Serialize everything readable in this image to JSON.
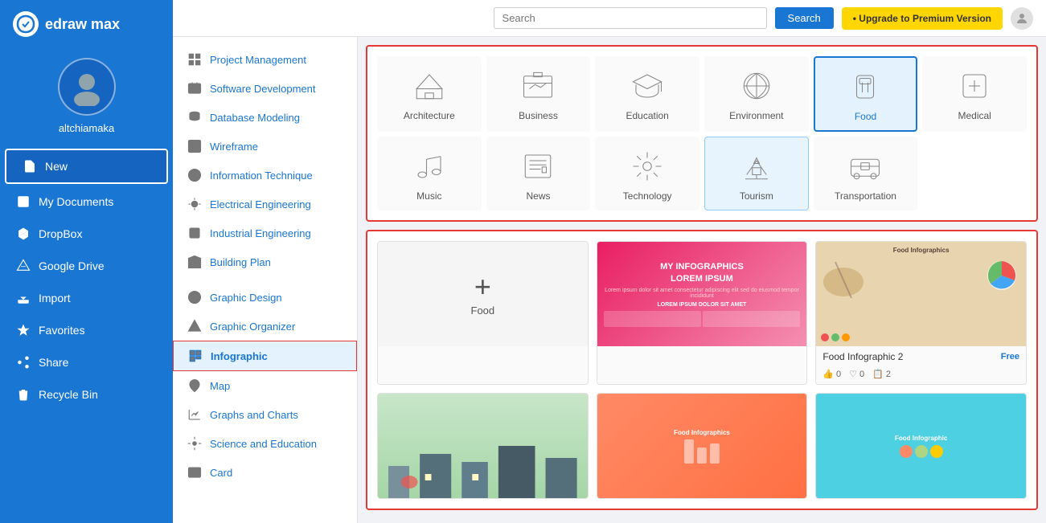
{
  "app": {
    "name": "edraw max"
  },
  "sidebar": {
    "username": "altchiamaka",
    "items": [
      {
        "id": "new",
        "label": "New",
        "active": true
      },
      {
        "id": "my-documents",
        "label": "My Documents",
        "active": false
      },
      {
        "id": "dropbox",
        "label": "DropBox",
        "active": false
      },
      {
        "id": "google-drive",
        "label": "Google Drive",
        "active": false
      },
      {
        "id": "import",
        "label": "Import",
        "active": false
      },
      {
        "id": "favorites",
        "label": "Favorites",
        "active": false
      },
      {
        "id": "share",
        "label": "Share",
        "active": false
      },
      {
        "id": "recycle-bin",
        "label": "Recycle Bin",
        "active": false
      }
    ]
  },
  "topbar": {
    "search_placeholder": "Search",
    "search_label": "Search",
    "upgrade_label": "Upgrade to Premium Version"
  },
  "left_menu": {
    "items": [
      {
        "id": "project-management",
        "label": "Project Management"
      },
      {
        "id": "software-development",
        "label": "Software Development"
      },
      {
        "id": "database-modeling",
        "label": "Database Modeling"
      },
      {
        "id": "wireframe",
        "label": "Wireframe"
      },
      {
        "id": "information-technique",
        "label": "Information Technique"
      },
      {
        "id": "electrical-engineering",
        "label": "Electrical Engineering"
      },
      {
        "id": "industrial-engineering",
        "label": "Industrial Engineering"
      },
      {
        "id": "building-plan",
        "label": "Building Plan"
      },
      {
        "id": "graphic-design",
        "label": "Graphic Design"
      },
      {
        "id": "graphic-organizer",
        "label": "Graphic Organizer"
      },
      {
        "id": "infographic",
        "label": "Infographic",
        "selected": true
      },
      {
        "id": "map",
        "label": "Map"
      },
      {
        "id": "graphs-and-charts",
        "label": "Graphs and Charts"
      },
      {
        "id": "science-and-education",
        "label": "Science and Education"
      },
      {
        "id": "card",
        "label": "Card"
      }
    ]
  },
  "categories": {
    "items": [
      {
        "id": "architecture",
        "label": "Architecture",
        "selected": false
      },
      {
        "id": "business",
        "label": "Business",
        "selected": false
      },
      {
        "id": "education",
        "label": "Education",
        "selected": false
      },
      {
        "id": "environment",
        "label": "Environment",
        "selected": false
      },
      {
        "id": "food",
        "label": "Food",
        "selected_blue": true
      },
      {
        "id": "medical",
        "label": "Medical",
        "selected": false
      },
      {
        "id": "music",
        "label": "Music",
        "selected": false
      },
      {
        "id": "news",
        "label": "News",
        "selected": false
      },
      {
        "id": "technology",
        "label": "Technology",
        "selected": false
      },
      {
        "id": "tourism",
        "label": "Tourism",
        "selected_light": true
      },
      {
        "id": "transportation",
        "label": "Transportation",
        "selected": false
      }
    ]
  },
  "templates": {
    "items": [
      {
        "id": "blank",
        "label": "Food",
        "name": "",
        "badge": "",
        "type": "blank"
      },
      {
        "id": "my-infographics",
        "name": "MY INFOGRAPHICS\nLOREM IPSUM",
        "badge": "",
        "type": "pink"
      },
      {
        "id": "food-infographic-2",
        "name": "Food Infographic 2",
        "badge": "Free",
        "type": "food",
        "likes": "0",
        "hearts": "0",
        "copies": "2"
      }
    ]
  }
}
